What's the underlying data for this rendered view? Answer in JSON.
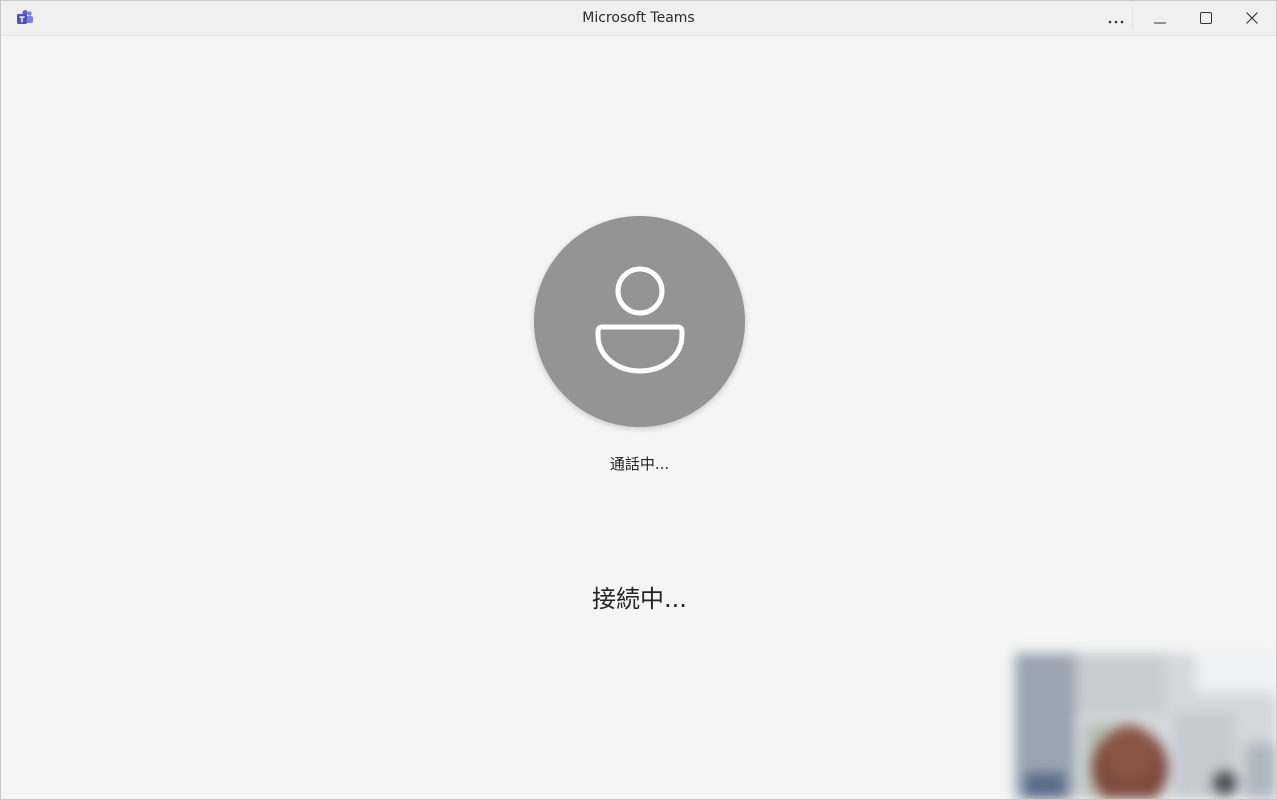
{
  "window": {
    "title": "Microsoft Teams",
    "app_icon": "teams-icon",
    "controls": {
      "more": "more-options-icon",
      "minimize": "minimize-icon",
      "maximize": "maximize-icon",
      "close": "close-icon"
    }
  },
  "call": {
    "avatar_icon": "person-icon",
    "status_small": "通話中...",
    "status_large": "接続中..."
  },
  "colors": {
    "background": "#f5f5f5",
    "avatar_bg": "#949494",
    "teams_brand": "#5b5fc7"
  }
}
